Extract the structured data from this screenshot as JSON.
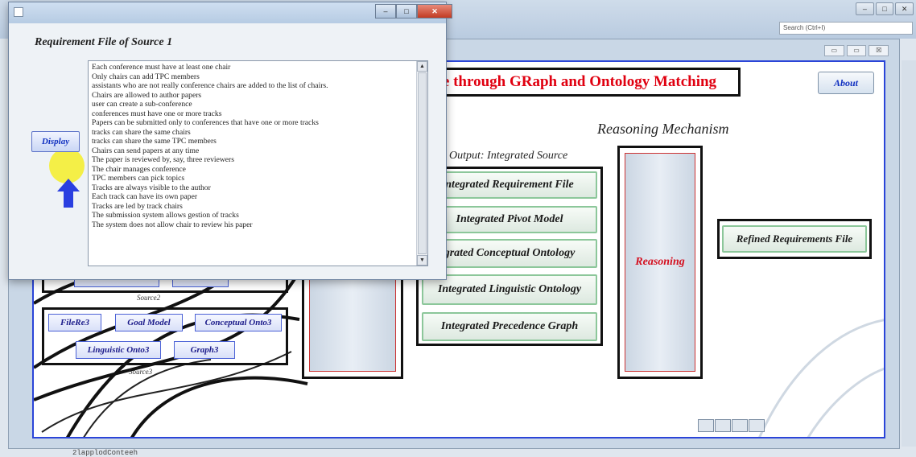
{
  "os": {
    "search_placeholder": "Search (Ctrl+I)",
    "buttons": [
      "–",
      "□",
      "✕"
    ]
  },
  "app": {
    "title": "e through GRaph and Ontology Matching",
    "about_label": "About",
    "inner_buttons": [
      "▭",
      "▭",
      "☒"
    ],
    "reasoning_mechanism_heading": "Reasoning Mechanism",
    "output_heading": "Output: Integrated Source",
    "integrated_buttons": [
      "ntegrated Requirement File",
      "Integrated Pivot Model",
      "grated Conceptual Ontology",
      "Integrated Linguistic Ontology",
      "Integrated Precedence Graph"
    ],
    "reasoning_label": "Reasoning",
    "refined_label": "Refined Requirements File",
    "source2_label": "Source2",
    "source3_label": "Source3",
    "source3_buttons": {
      "filere": "FileRe3",
      "goal_model": "Goal Model",
      "conceptual_onto": "Conceptual Onto3",
      "linguistic_onto": "Linguistic Onto3",
      "graph": "Graph3"
    }
  },
  "dialog": {
    "heading": "Requirement File of Source 1",
    "window_buttons": [
      "–",
      "□",
      "✕"
    ],
    "display_label": "Display",
    "lines": [
      "Each conference must have at least one chair",
      "Only chairs can add TPC members",
      "assistants who are not really conference chairs are added to the list of chairs.",
      "Chairs are allowed to author papers",
      "user can create a sub-conference",
      "conferences must have one or more tracks",
      "Papers can be submitted only to conferences that have one or more tracks",
      "tracks can share the same chairs",
      "tracks can share the same TPC members",
      "Chairs can send papers at any time",
      "The paper is reviewed by, say, three reviewers",
      "The chair manages conference",
      "TPC members can pick topics",
      "Tracks are always visible to the author",
      "Each track can have its own paper",
      "Tracks are led by track chairs",
      "The submission system allows gestion of tracks",
      "The system does not allow chair to review his paper"
    ],
    "scroll_up": "▲",
    "scroll_down": "▼"
  },
  "status": {
    "text": "2lapplodConteeh"
  },
  "colors": {
    "title_red": "#e00010",
    "canvas_border": "#2b45d8",
    "green_border": "#8cc79a"
  }
}
